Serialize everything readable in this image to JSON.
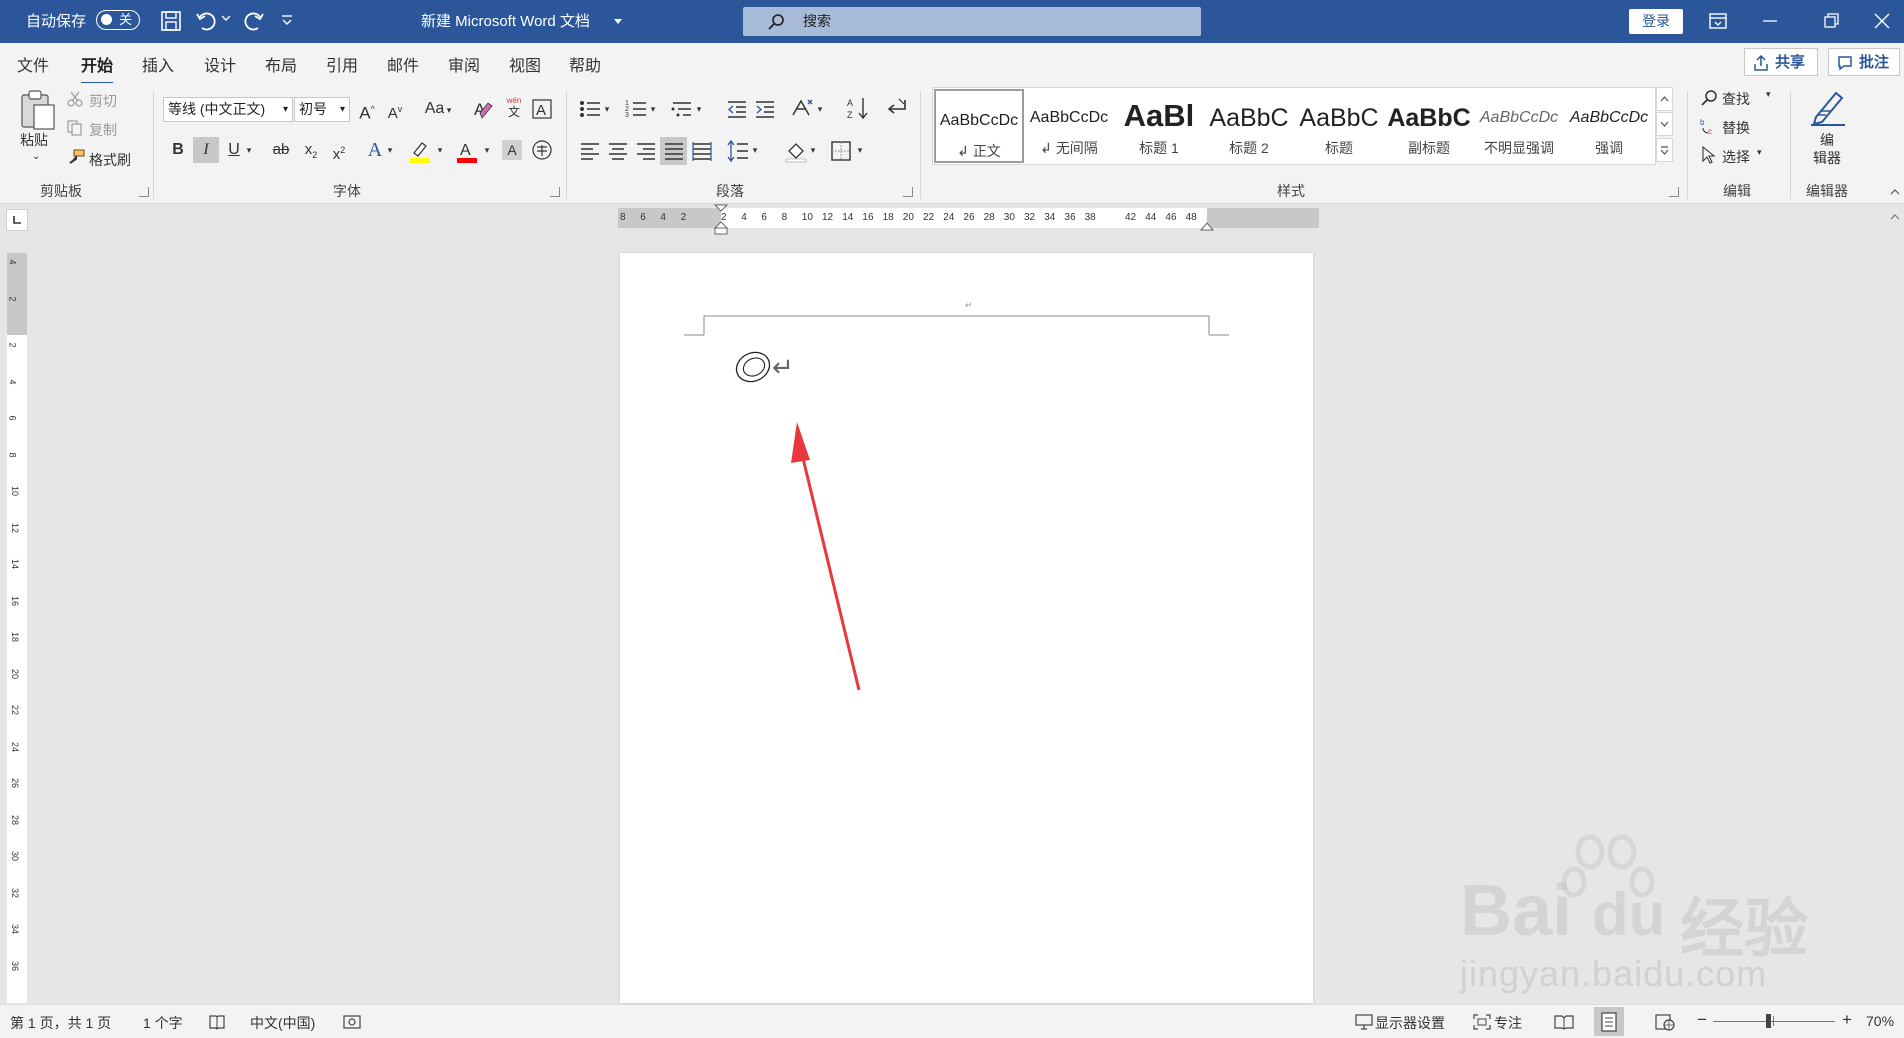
{
  "titlebar": {
    "autosave_label": "自动保存",
    "autosave_state": "关",
    "doc_title": "新建 Microsoft Word 文档",
    "search_placeholder": "搜索",
    "login_label": "登录"
  },
  "tabs": [
    "文件",
    "开始",
    "插入",
    "设计",
    "布局",
    "引用",
    "邮件",
    "审阅",
    "视图",
    "帮助"
  ],
  "active_tab": "开始",
  "share_label": "共享",
  "comment_label": "批注",
  "clipboard": {
    "paste": "粘贴",
    "cut": "剪切",
    "copy": "复制",
    "format_painter": "格式刷",
    "group_label": "剪贴板"
  },
  "font": {
    "font_name": "等线 (中文正文)",
    "font_size": "初号",
    "change_case": "Aa",
    "phonetic_top": "wén",
    "phonetic_bottom": "文",
    "group_label": "字体"
  },
  "paragraph": {
    "group_label": "段落"
  },
  "styles": {
    "items": [
      {
        "preview": "AaBbCcDc",
        "name": "正文"
      },
      {
        "preview": "AaBbCcDc",
        "name": "无间隔"
      },
      {
        "preview": "AaBl",
        "name": "标题 1"
      },
      {
        "preview": "AaBbC",
        "name": "标题 2"
      },
      {
        "preview": "AaBbC",
        "name": "标题"
      },
      {
        "preview": "AaBbC",
        "name": "副标题"
      },
      {
        "preview": "AaBbCcDc",
        "name": "不明显强调"
      },
      {
        "preview": "AaBbCcDc",
        "name": "强调"
      }
    ],
    "group_label": "样式"
  },
  "editing": {
    "find": "查找",
    "replace": "替换",
    "select": "选择",
    "group_label": "编辑"
  },
  "editor": {
    "label_line1": "编",
    "label_line2": "辑器",
    "group_label": "编辑器"
  },
  "ruler": {
    "h_numbers": [
      "8",
      "6",
      "4",
      "2",
      "2",
      "4",
      "6",
      "8",
      "10",
      "12",
      "14",
      "16",
      "18",
      "20",
      "22",
      "24",
      "26",
      "28",
      "30",
      "32",
      "34",
      "36",
      "38",
      "42",
      "44",
      "46",
      "48"
    ],
    "v_numbers": [
      "4",
      "2",
      "2",
      "4",
      "6",
      "8",
      "10",
      "12",
      "14",
      "16",
      "18",
      "20",
      "22",
      "24",
      "26",
      "28",
      "30",
      "32",
      "34",
      "36"
    ]
  },
  "document": {
    "header_mark": "↵",
    "content_symbol": "◎",
    "paragraph_mark": "↵"
  },
  "status": {
    "page_info": "第 1 页，共 1 页",
    "word_count": "1 个字",
    "language": "中文(中国)",
    "display_settings": "显示器设置",
    "focus": "专注",
    "zoom_minus": "−",
    "zoom_plus": "+",
    "zoom": "70%",
    "zoom_fraction": 0.45
  },
  "watermark": {
    "brand": "Bai",
    "brand2": "du",
    "suffix": "经验",
    "url": "jingyan.baidu.com"
  },
  "colors": {
    "word_blue": "#2b579a",
    "arrow_red": "#e8383d",
    "highlight": "#ffff00",
    "font_color": "#ff0000"
  }
}
